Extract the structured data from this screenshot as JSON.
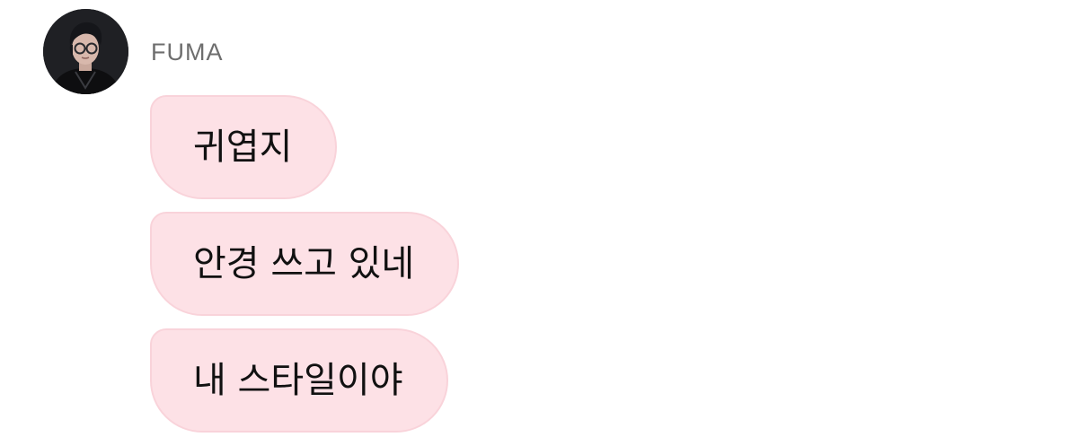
{
  "sender": {
    "name": "FUMA"
  },
  "messages": [
    {
      "text": "귀엽지"
    },
    {
      "text": "안경 쓰고 있네"
    },
    {
      "text": "내 스타일이야"
    }
  ],
  "colors": {
    "bubble_background": "#fde1e6",
    "bubble_border": "#f9d3da",
    "sender_name": "#6e6e6e",
    "message_text": "#111111",
    "page_background": "#ffffff"
  }
}
